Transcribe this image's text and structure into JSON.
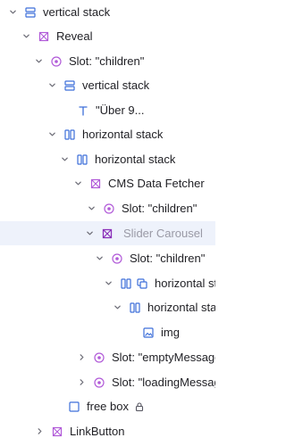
{
  "rows": [
    {
      "label": "vertical stack",
      "icon": "vertical-stack-icon"
    },
    {
      "label": "Reveal",
      "icon": "component-icon"
    },
    {
      "label": "Slot: \"children\"",
      "icon": "slot-icon"
    },
    {
      "label": "vertical stack",
      "icon": "vertical-stack-icon"
    },
    {
      "label": "\"Über 9...",
      "icon": "text-icon"
    },
    {
      "label": "horizontal stack",
      "icon": "horizontal-stack-icon"
    },
    {
      "label": "horizontal stack",
      "icon": "horizontal-stack-icon"
    },
    {
      "label": "CMS Data Fetcher",
      "icon": "component-icon"
    },
    {
      "label": "Slot: \"children\"",
      "icon": "slot-icon"
    },
    {
      "label": "Slider Carousel",
      "icon": "component-icon",
      "selected": true
    },
    {
      "label": "Slot: \"children\"",
      "icon": "slot-icon"
    },
    {
      "label": "horizontal stack",
      "icon": "horizontal-stack-icon",
      "secondary_icon": "repeat-icon"
    },
    {
      "label": "horizontal stack",
      "icon": "horizontal-stack-icon"
    },
    {
      "label": "img",
      "icon": "image-icon"
    },
    {
      "label": "Slot: \"emptyMessage\"",
      "icon": "slot-icon"
    },
    {
      "label": "Slot: \"loadingMessage\"",
      "icon": "slot-icon"
    },
    {
      "label": "free box",
      "icon": "free-box-icon",
      "locked": true
    },
    {
      "label": "LinkButton",
      "icon": "component-icon"
    }
  ],
  "colors": {
    "stack_icon": "#3d6fd9",
    "component_icon": "#b15ad8",
    "slot_icon": "#b15ad8",
    "selected_row": "#eef2fb",
    "chevron": "#6b6b75"
  }
}
